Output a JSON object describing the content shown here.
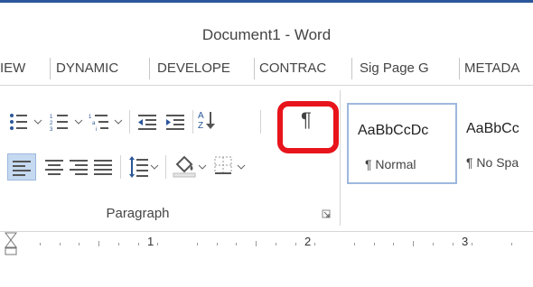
{
  "window": {
    "title": "Document1 - Word",
    "accent": "#2b579a"
  },
  "tabs": [
    {
      "label": "IEW"
    },
    {
      "label": "DYNAMIC"
    },
    {
      "label": "DEVELOPE"
    },
    {
      "label": "CONTRAC"
    },
    {
      "label": "Sig Page G"
    },
    {
      "label": "METADA"
    }
  ],
  "paragraph_group": {
    "label": "Paragraph",
    "show_hide_glyph": "¶",
    "icons": [
      "bullets-icon",
      "numbering-icon",
      "multilevel-list-icon",
      "decrease-indent-icon",
      "increase-indent-icon",
      "sort-icon",
      "show-hide-formatting-icon",
      "align-left-icon",
      "center-icon",
      "align-right-icon",
      "justify-icon",
      "line-spacing-icon",
      "shading-icon",
      "borders-icon",
      "dialog-launcher-icon"
    ],
    "highlight_color": "#e8141b"
  },
  "styles_group": {
    "items": [
      {
        "sample": "AaBbCcDc",
        "name": "¶ Normal"
      },
      {
        "sample": "AaBbCc",
        "name": "¶ No Spa"
      }
    ]
  },
  "ruler": {
    "numbers": [
      "1",
      "2",
      "3"
    ]
  }
}
